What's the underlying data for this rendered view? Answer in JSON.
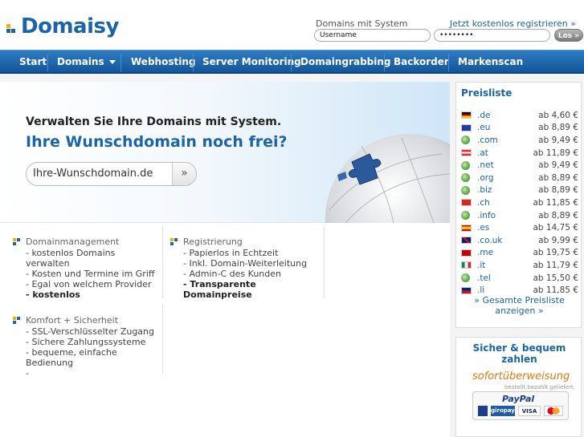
{
  "brand": {
    "name": "Domaisy",
    "colors": {
      "primary": "#1b64a8",
      "accent_yellow": "#f2b200",
      "accent_blue": "#1b64a8",
      "nav": "#1f6bb3"
    }
  },
  "login": {
    "title": "Domains mit System",
    "register_link": "Jetzt kostenlos registrieren »",
    "username_value": "Username",
    "password_value": "••••••••",
    "submit_label": "Los »"
  },
  "nav": {
    "items": [
      {
        "label": "Start"
      },
      {
        "label": "Domains",
        "has_dropdown": true
      },
      {
        "label": "Webhosting"
      },
      {
        "label": "Server Monitoring"
      },
      {
        "label": "Domaingrabbing"
      },
      {
        "label": "Backorder"
      },
      {
        "label": "Markenscan"
      }
    ]
  },
  "hero": {
    "headline": "Verwalten Sie Ihre Domains mit System.",
    "subheadline": "Ihre Wunschdomain noch frei?",
    "search_value": "Ihre-Wunschdomain.de",
    "search_button": "»"
  },
  "features": [
    {
      "title": "Domainmanagement",
      "items": [
        "- kostenlos Domains verwalten",
        "- Kosten und Termine im Griff",
        "- Egal von welchem Provider",
        "- kostenlos"
      ],
      "bold_last": true
    },
    {
      "title": "Registrierung",
      "items": [
        "- Papierlos in Echtzeit",
        "- Inkl. Domain-Weiterleitung",
        "- Admin-C des Kunden",
        "- Transparente Domainpreise"
      ],
      "bold_last": true
    },
    {
      "title": "Komfort + Sicherheit",
      "items": [
        "- SSL-Verschlüsselter Zugang",
        "- Sichere Zahlungssysteme",
        "- bequeme, einfache Bedienung",
        "-"
      ],
      "bold_last": false
    }
  ],
  "pricelist": {
    "title": "Preisliste",
    "rows": [
      {
        "tld": ".de",
        "price": "ab 4,60 €",
        "flag": "de"
      },
      {
        "tld": ".eu",
        "price": "ab 8,89 €",
        "flag": "eu"
      },
      {
        "tld": ".com",
        "price": "ab 9,49 €",
        "flag": "globe"
      },
      {
        "tld": ".at",
        "price": "ab 11,89 €",
        "flag": "at"
      },
      {
        "tld": ".net",
        "price": "ab 9,49 €",
        "flag": "globe"
      },
      {
        "tld": ".org",
        "price": "ab 8,89 €",
        "flag": "globe"
      },
      {
        "tld": ".biz",
        "price": "ab 8,89 €",
        "flag": "globe"
      },
      {
        "tld": ".ch",
        "price": "ab 11,85 €",
        "flag": "ch"
      },
      {
        "tld": ".info",
        "price": "ab 8,89 €",
        "flag": "globe"
      },
      {
        "tld": ".es",
        "price": "ab 14,75 €",
        "flag": "es"
      },
      {
        "tld": ".co.uk",
        "price": "ab 9,99 €",
        "flag": "uk"
      },
      {
        "tld": ".me",
        "price": "ab 19,75 €",
        "flag": "me"
      },
      {
        "tld": ".it",
        "price": "ab 11,79 €",
        "flag": "it"
      },
      {
        "tld": ".tel",
        "price": "ab 15,50 €",
        "flag": "globe"
      },
      {
        "tld": ".li",
        "price": "ab 11,85 €",
        "flag": "li"
      }
    ],
    "all_link": "» Gesamte Preisliste anzeigen »"
  },
  "payment": {
    "title": "Sicher & bequem zahlen",
    "sofort": "sofortüberweisung",
    "sofort_sub": "bestellt.bezahlt.geliefert.",
    "paypal": "PayPal",
    "cards": [
      "giropay",
      "VISA"
    ]
  }
}
